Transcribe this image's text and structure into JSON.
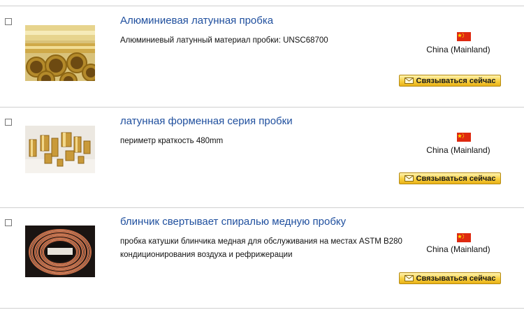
{
  "contact_label": "Связываться сейчас",
  "colors": {
    "title_link": "#1f4f9e",
    "button_top": "#fff3b0",
    "button_bottom": "#e9b217",
    "flag_red": "#de2910",
    "flag_star": "#ffde00"
  },
  "icons": {
    "flag": "china-flag-icon",
    "mail": "envelope-icon"
  },
  "products": [
    {
      "title": "Алюминиевая латунная пробка",
      "description": "Алюминиевый латунный материал пробки: UNSC68700",
      "country": "China (Mainland)",
      "image": "brass-tubes-photo"
    },
    {
      "title": "латунная форменная серия пробки",
      "description": "периметр краткость 480mm",
      "country": "China (Mainland)",
      "image": "brass-fittings-photo"
    },
    {
      "title": "блинчик свертывает спиралью медную пробку",
      "description": "пробка катушки блинчика медная для обслуживания на местах ASTM B280 кондиционирования воздуха и рефрижерации",
      "country": "China (Mainland)",
      "image": "copper-coil-photo"
    }
  ]
}
